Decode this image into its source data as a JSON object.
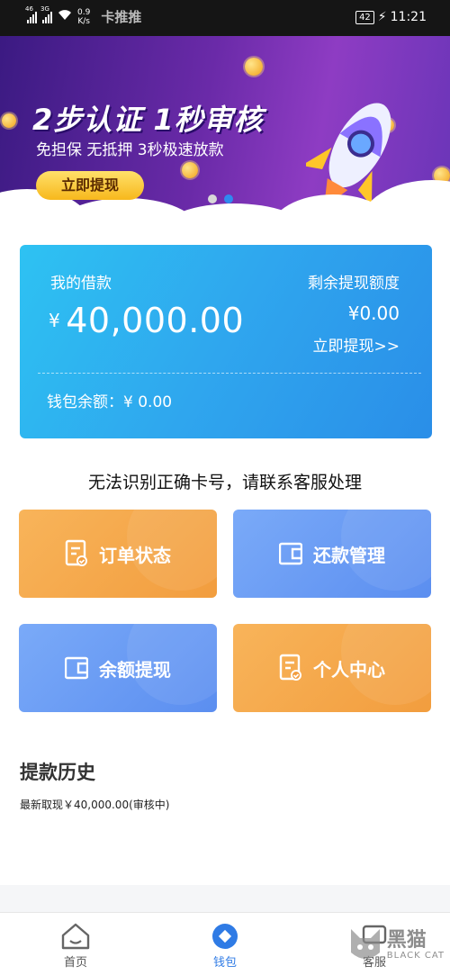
{
  "statusbar": {
    "signal1": "46",
    "signal2": "3G",
    "speed_value": "0.9",
    "speed_unit": "K/s",
    "app_name": "卡推推",
    "battery": "42",
    "time": "11:21"
  },
  "banner": {
    "title": "2步认证 1秒审核",
    "subtitle": "免担保 无抵押 3秒极速放款",
    "button": "立即提现",
    "pages": 2,
    "active_page": 2
  },
  "loan_card": {
    "label": "我的借款",
    "currency": "¥",
    "amount": "40,000.00",
    "remaining_label": "剩余提现额度",
    "remaining_value": "¥0.00",
    "withdraw_link": "立即提现>>",
    "wallet_balance": "钱包余额：¥ 0.00"
  },
  "notice": "无法识别正确卡号，请联系客服处理",
  "tiles": [
    {
      "label": "订单状态",
      "icon": "order-document-icon",
      "color": "#f5a84a"
    },
    {
      "label": "还款管理",
      "icon": "wallet-icon",
      "color": "#6a9af3"
    },
    {
      "label": "余额提现",
      "icon": "wallet-icon",
      "color": "#6a9af3"
    },
    {
      "label": "个人中心",
      "icon": "profile-document-icon",
      "color": "#f5a84a"
    }
  ],
  "history": {
    "title": "提款历史",
    "latest": "最新取现￥40,000.00(审核中)"
  },
  "nav": {
    "home": "首页",
    "wallet": "钱包",
    "service": "客服",
    "active": "wallet"
  },
  "watermark": {
    "text": "黑猫",
    "sub": "BLACK CAT"
  },
  "colors": {
    "accent": "#2f7be5",
    "card": "#2fa6ee",
    "orange_tile": "#f5a84a",
    "blue_tile": "#6a9af3"
  }
}
